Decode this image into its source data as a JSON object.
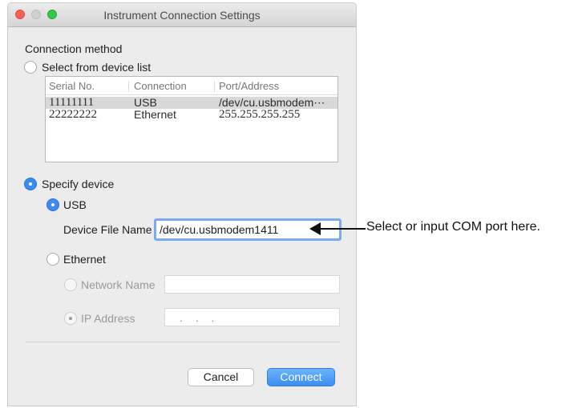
{
  "window": {
    "title": "Instrument Connection Settings"
  },
  "connection": {
    "section_label": "Connection method",
    "select_from_list_label": "Select from device list",
    "list": {
      "columns": [
        "Serial No.",
        "Connection",
        "Port/Address"
      ],
      "rows": [
        [
          "11111111",
          "USB",
          "/dev/cu.usbmodem⋯"
        ],
        [
          "22222222",
          "Ethernet",
          "255.255.255.255"
        ]
      ]
    },
    "specify_device_label": "Specify device",
    "usb_label": "USB",
    "device_file_name_label": "Device File Name",
    "device_file_name_value": "/dev/cu.usbmodem1411",
    "ethernet_label": "Ethernet",
    "network_name_label": "Network Name",
    "network_name_value": "",
    "ip_address_label": "IP Address",
    "ip_address_value": ". . ."
  },
  "buttons": {
    "cancel": "Cancel",
    "connect": "Connect"
  },
  "annotation": {
    "text": "Select or input COM port here."
  },
  "state": {
    "method": "Specify device",
    "interface": "USB"
  },
  "colors": {
    "accent": "#3b8bf0",
    "focus_ring": "#7aaaf3",
    "close": "#fc5f57",
    "zoom": "#34c748"
  }
}
